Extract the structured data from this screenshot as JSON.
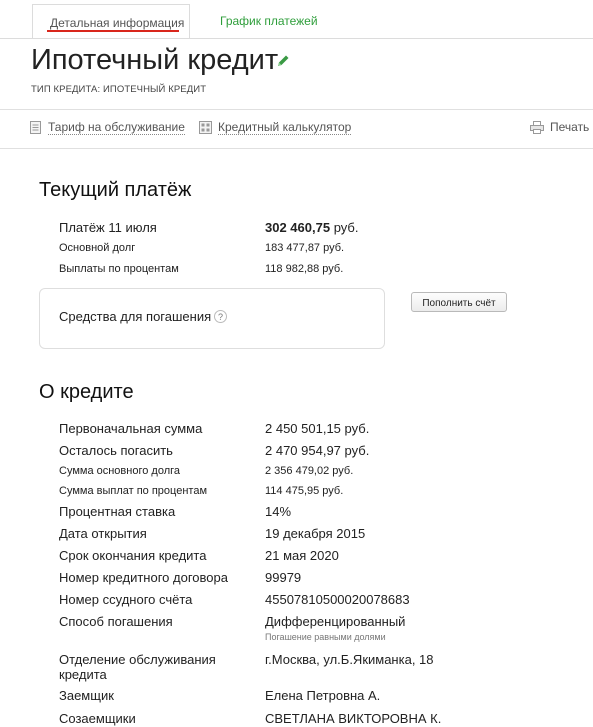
{
  "tabs": {
    "active": "Детальная информация",
    "other": "График платежей"
  },
  "header": {
    "title": "Ипотечный кредит",
    "subtitle": "ТИП КРЕДИТА: ИПОТЕЧНЫЙ КРЕДИТ"
  },
  "toolbar": {
    "tariff": "Тариф на обслуживание",
    "calculator": "Кредитный калькулятор",
    "print": "Печать"
  },
  "current_payment": {
    "title": "Текущий платёж",
    "rows": [
      {
        "label": "Платёж 11 июля",
        "value_bold": "302 460,75",
        "value_suffix": " руб."
      },
      {
        "label": "Основной долг",
        "value": "183 477,87 руб."
      },
      {
        "label": "Выплаты по процентам",
        "value": "118 982,88 руб."
      }
    ],
    "funds_label": "Средства для погашения",
    "help": "?",
    "topup_button": "Пополнить счёт"
  },
  "about": {
    "title": "О кредите",
    "rows": [
      {
        "label": "Первоначальная сумма",
        "value": "2 450 501,15 руб."
      },
      {
        "label": "Осталось погасить",
        "value": "2 470 954,97 руб."
      },
      {
        "label": "Сумма основного долга",
        "value": "2 356 479,02 руб."
      },
      {
        "label": "Сумма выплат по процентам",
        "value": "114 475,95 руб."
      },
      {
        "label": "Процентная ставка",
        "value": "14%"
      },
      {
        "label": "Дата открытия",
        "value": "19 декабря 2015"
      },
      {
        "label": "Срок окончания кредита",
        "value": "21 мая 2020"
      },
      {
        "label": "Номер кредитного договора",
        "value": "99979"
      },
      {
        "label": "Номер ссудного счёта",
        "value": "45507810500020078683"
      },
      {
        "label": "Способ погашения",
        "value": "Дифференцированный",
        "note": "Погашение равными долями"
      },
      {
        "label": "Отделение обслуживания кредита",
        "value": "г.Москва, ул.Б.Якиманка, 18"
      },
      {
        "label": "Заемщик",
        "value": "Елена Петровна А."
      },
      {
        "label": "Созаемщики",
        "value": "СВЕТЛАНА ВИКТОРОВНА К."
      }
    ]
  },
  "colors": {
    "accent_green": "#2f9e3b",
    "accent_red": "#d9261c",
    "edit_icon": "#3a9a44"
  },
  "icons": {
    "edit": "pencil-icon",
    "tariff": "document-icon",
    "calculator": "calculator-icon",
    "print": "printer-icon",
    "help": "question-icon"
  }
}
